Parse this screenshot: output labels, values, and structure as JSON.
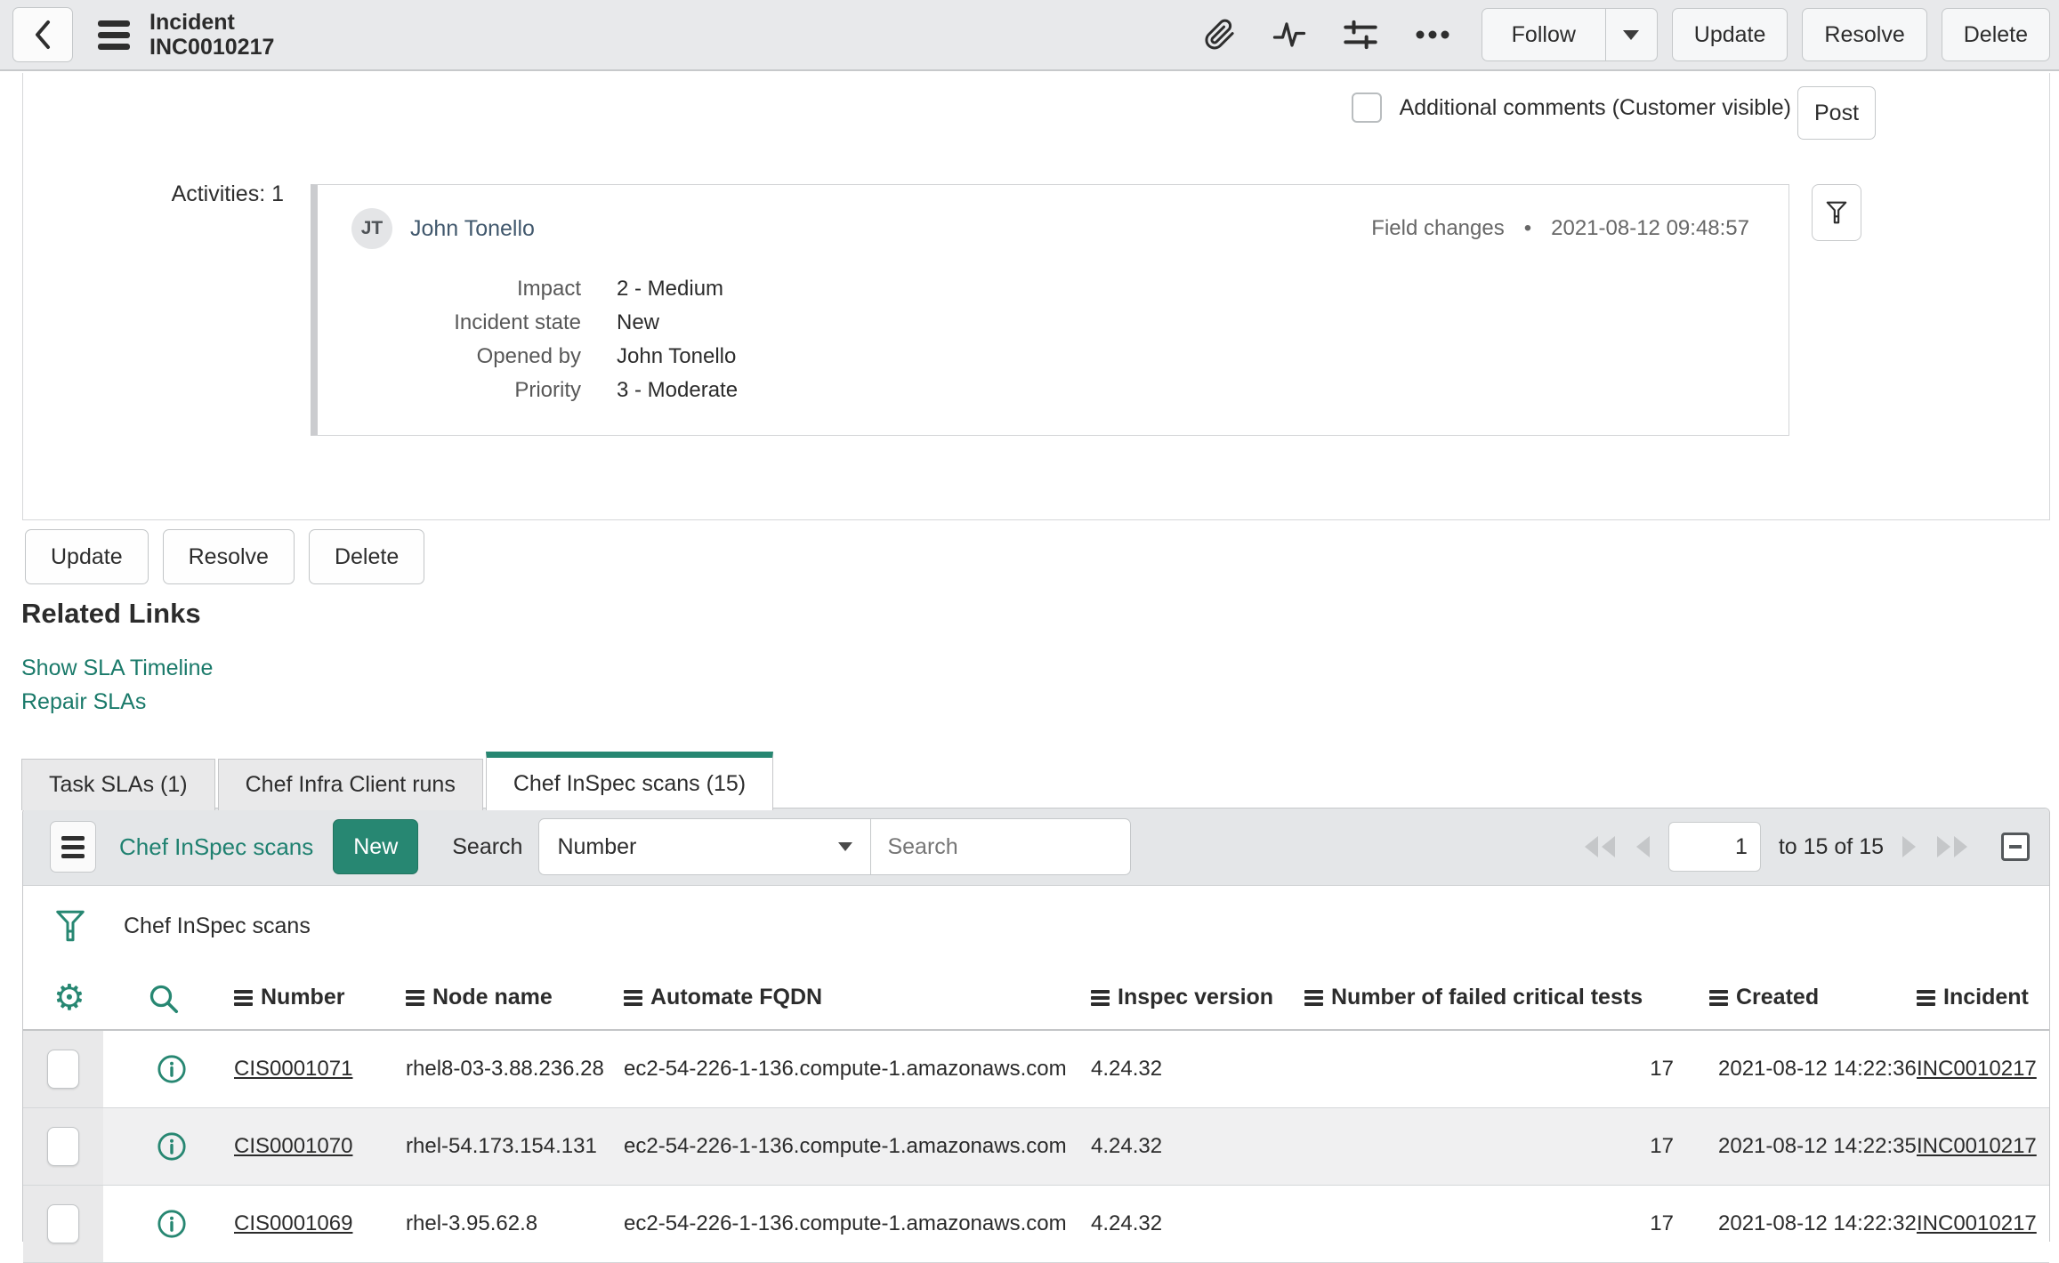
{
  "header": {
    "title_line1": "Incident",
    "title_line2": "INC0010217",
    "follow_label": "Follow",
    "update_label": "Update",
    "resolve_label": "Resolve",
    "delete_label": "Delete"
  },
  "form": {
    "comments_label": "Additional comments (Customer visible)",
    "post_label": "Post",
    "activities_label": "Activities: 1",
    "activity": {
      "avatar_initials": "JT",
      "author": "John Tonello",
      "type": "Field changes",
      "separator": "•",
      "timestamp": "2021-08-12 09:48:57",
      "fields": [
        {
          "label": "Impact",
          "value": "2 - Medium"
        },
        {
          "label": "Incident state",
          "value": "New"
        },
        {
          "label": "Opened by",
          "value": "John Tonello"
        },
        {
          "label": "Priority",
          "value": "3 - Moderate"
        }
      ]
    },
    "footer_update": "Update",
    "footer_resolve": "Resolve",
    "footer_delete": "Delete"
  },
  "related_links": {
    "title": "Related Links",
    "link1": "Show SLA Timeline",
    "link2": "Repair SLAs"
  },
  "tabs": [
    {
      "label": "Task SLAs (1)"
    },
    {
      "label": "Chef Infra Client runs"
    },
    {
      "label": "Chef InSpec scans (15)"
    }
  ],
  "list": {
    "title": "Chef InSpec scans",
    "new_button": "New",
    "search_label": "Search",
    "search_field_selected": "Number",
    "search_placeholder": "Search",
    "pagination": {
      "page": "1",
      "range_text": "to 15 of 15"
    },
    "filter_breadcrumb": "Chef InSpec scans",
    "columns": [
      "Number",
      "Node name",
      "Automate FQDN",
      "Inspec version",
      "Number of failed critical tests",
      "Created",
      "Incident"
    ],
    "rows": [
      {
        "number": "CIS0001071",
        "node_name": "rhel8-03-3.88.236.28",
        "automate_fqdn": "ec2-54-226-1-136.compute-1.amazonaws.com",
        "inspec_version": "4.24.32",
        "failed_critical_tests": "17",
        "created": "2021-08-12 14:22:36",
        "incident": "INC0010217"
      },
      {
        "number": "CIS0001070",
        "node_name": "rhel-54.173.154.131",
        "automate_fqdn": "ec2-54-226-1-136.compute-1.amazonaws.com",
        "inspec_version": "4.24.32",
        "failed_critical_tests": "17",
        "created": "2021-08-12 14:22:35",
        "incident": "INC0010217"
      },
      {
        "number": "CIS0001069",
        "node_name": "rhel-3.95.62.8",
        "automate_fqdn": "ec2-54-226-1-136.compute-1.amazonaws.com",
        "inspec_version": "4.24.32",
        "failed_critical_tests": "17",
        "created": "2021-08-12 14:22:32",
        "incident": "INC0010217"
      }
    ]
  },
  "colors": {
    "accent_teal": "#278772",
    "link_teal": "#1a7a6a"
  }
}
